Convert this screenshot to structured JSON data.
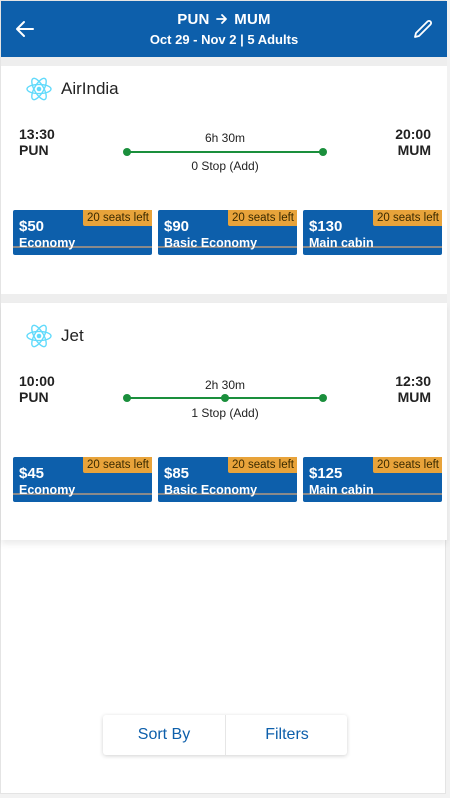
{
  "header": {
    "origin": "PUN",
    "destination": "MUM",
    "subtitle": "Oct 29 - Nov 2 | 5 Adults",
    "back_icon": "arrow-left-icon",
    "edit_icon": "pencil-icon"
  },
  "flights": [
    {
      "airline": "AirIndia",
      "depart_time": "13:30",
      "depart_code": "PUN",
      "arrive_time": "20:00",
      "arrive_code": "MUM",
      "duration": "6h 30m",
      "stops": "0 Stop (Add)",
      "fares": [
        {
          "price": "$50",
          "cabin": "Economy",
          "seats": "20 seats left"
        },
        {
          "price": "$90",
          "cabin": "Basic Economy",
          "seats": "20 seats left"
        },
        {
          "price": "$130",
          "cabin": "Main cabin",
          "seats": "20 seats left"
        }
      ]
    },
    {
      "airline": "Jet",
      "depart_time": "10:00",
      "depart_code": "PUN",
      "arrive_time": "12:30",
      "arrive_code": "MUM",
      "duration": "2h 30m",
      "stops": "1 Stop (Add)",
      "fares": [
        {
          "price": "$45",
          "cabin": "Economy",
          "seats": "20 seats left"
        },
        {
          "price": "$85",
          "cabin": "Basic Economy",
          "seats": "20 seats left"
        },
        {
          "price": "$125",
          "cabin": "Main cabin",
          "seats": "20 seats left"
        }
      ]
    }
  ],
  "bottom_bar": {
    "sort_label": "Sort By",
    "filter_label": "Filters"
  },
  "colors": {
    "primary": "#0d5fab",
    "route_line": "#1a8f3c",
    "seats_badge": "#e8a33a",
    "logo": "#61dafb"
  }
}
